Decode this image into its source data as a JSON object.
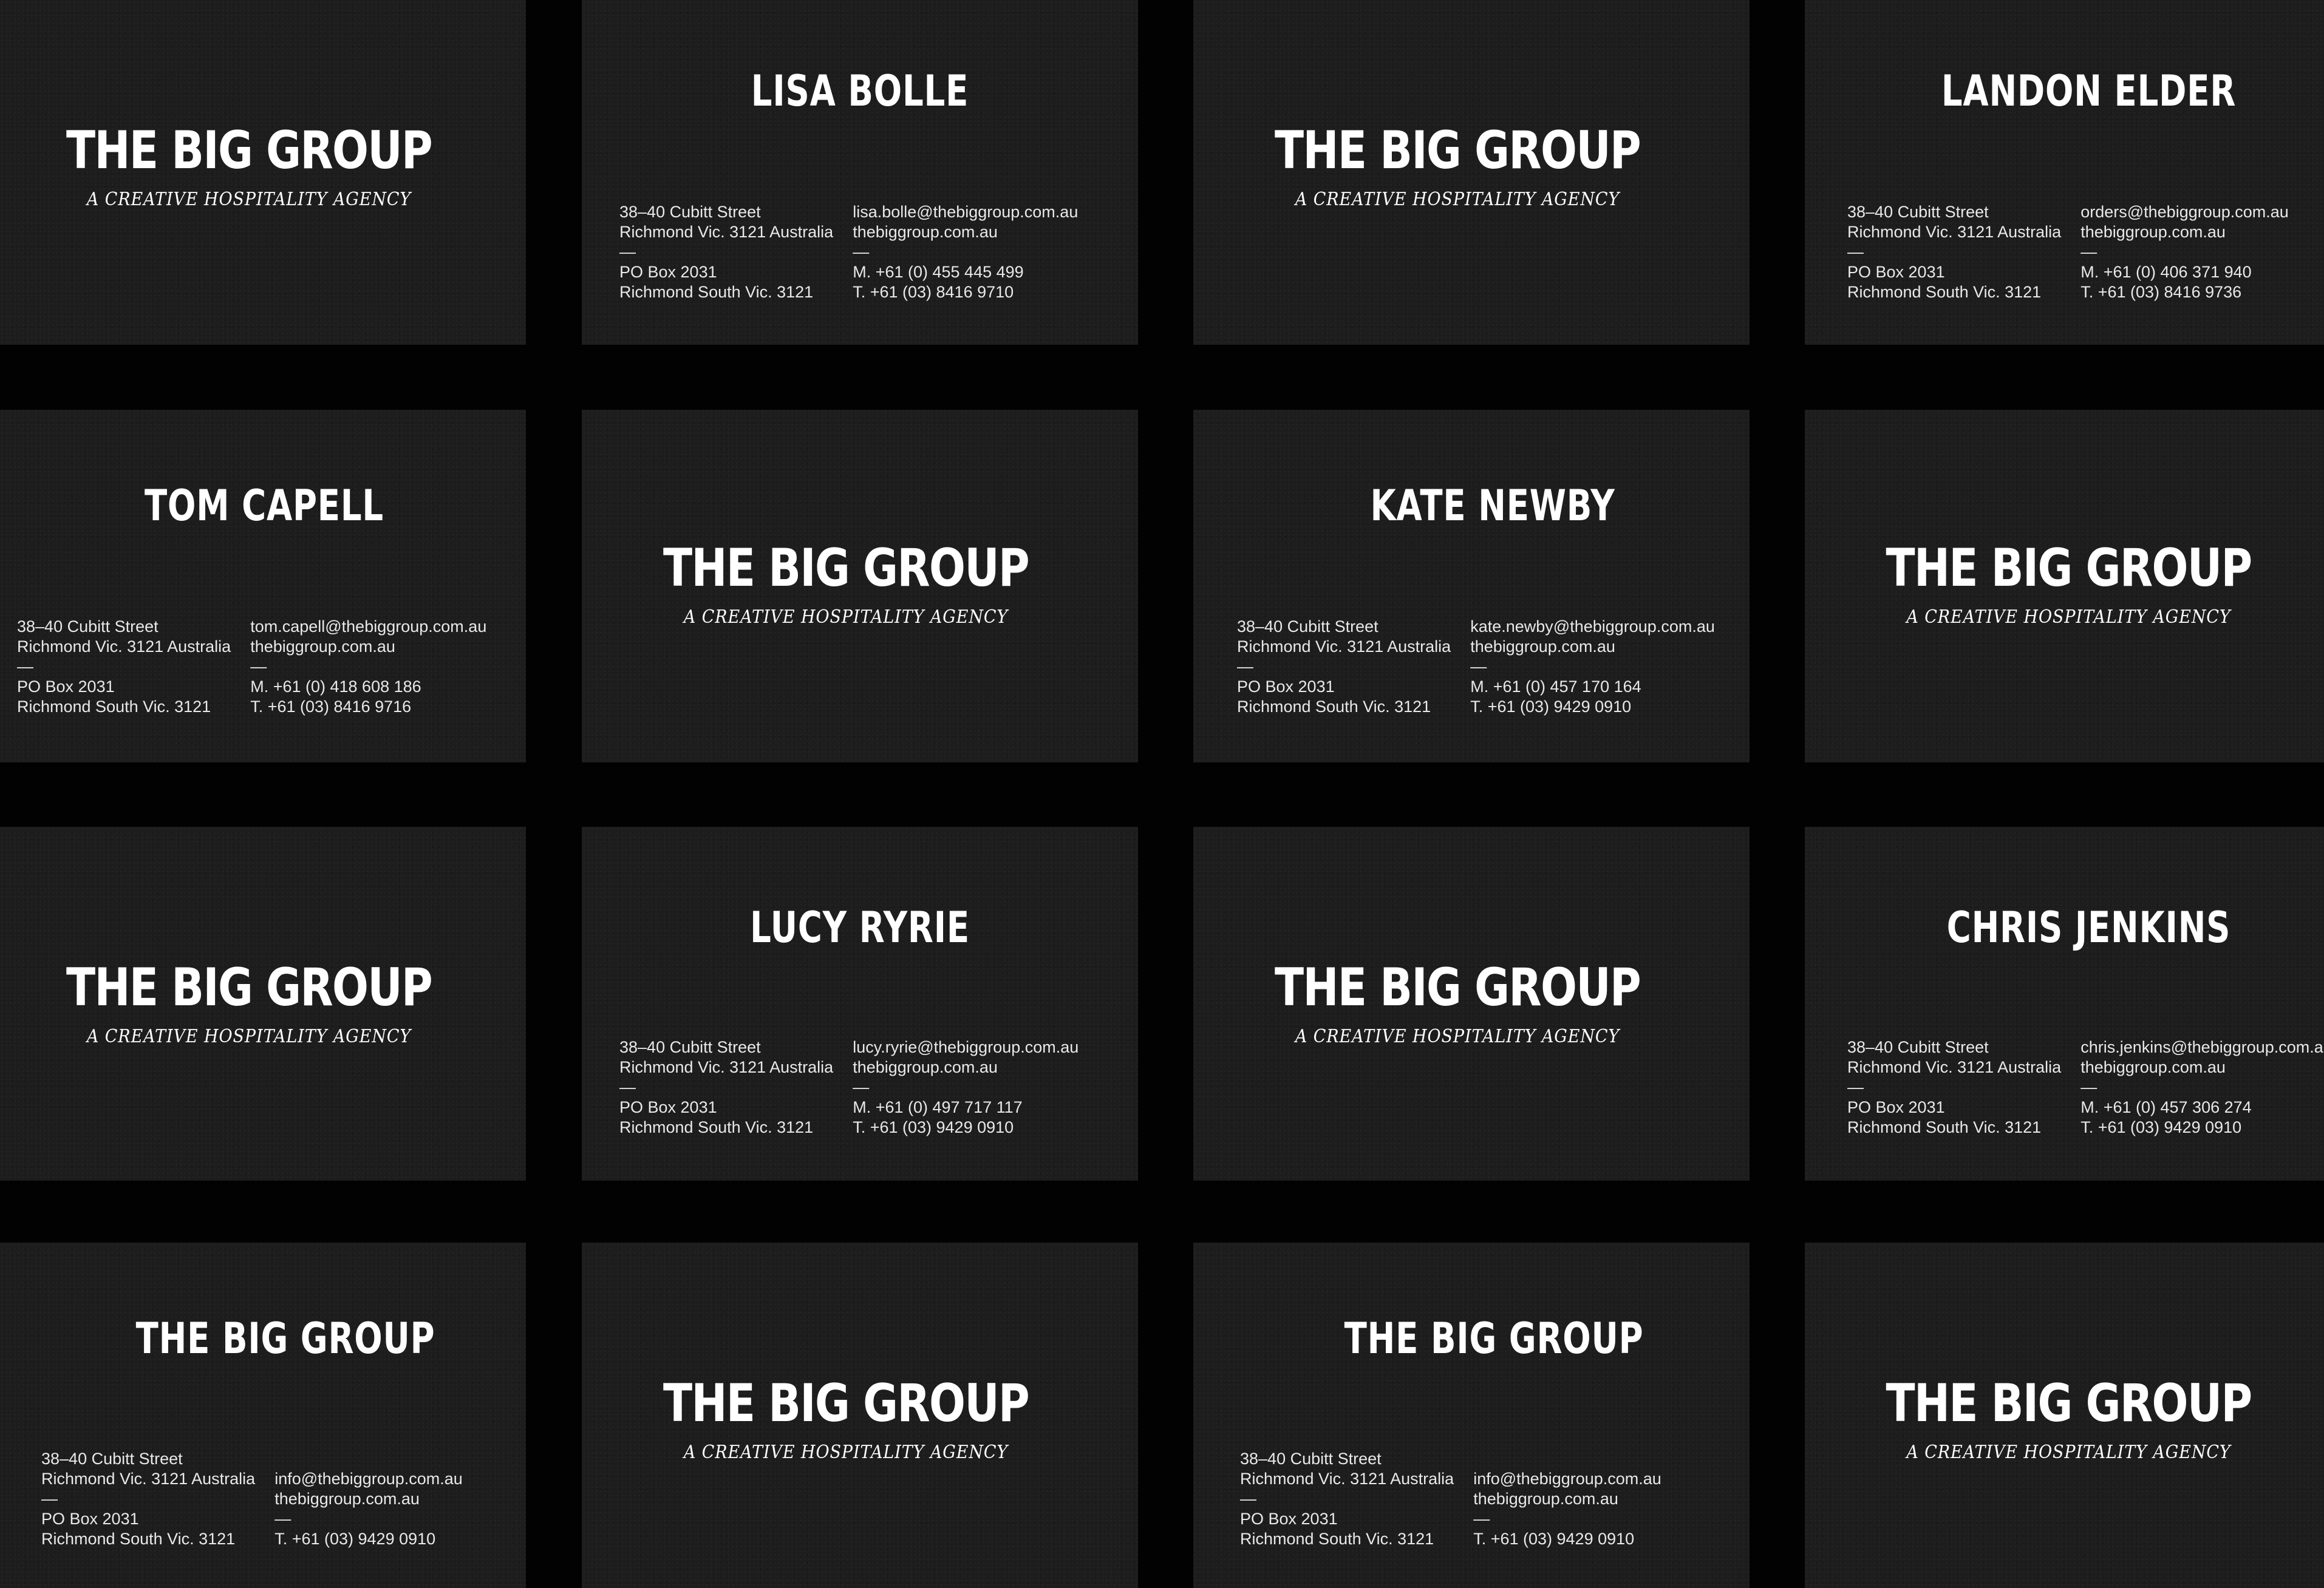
{
  "brand": {
    "logo": "THE BIG GROUP",
    "tagline": "A CREATIVE HOSPITALITY AGENCY"
  },
  "common": {
    "street": "38–40 Cubitt Street",
    "suburb": "Richmond Vic. 3121 Australia",
    "dash": "—",
    "po_box": "PO Box 2031",
    "po_suburb": "Richmond South Vic. 3121",
    "website": "thebiggroup.com.au"
  },
  "cards": {
    "lisa": {
      "name": "LISA BOLLE",
      "email": "lisa.bolle@thebiggroup.com.au",
      "mobile": "M. +61 (0) 455 445 499",
      "tel": "T.  +61 (03) 8416 9710"
    },
    "landon": {
      "name": "LANDON ELDER",
      "email": "orders@thebiggroup.com.au",
      "mobile": "M. +61 (0) 406 371 940",
      "tel": "T.  +61 (03) 8416 9736"
    },
    "tom": {
      "name": "TOM CAPELL",
      "email": "tom.capell@thebiggroup.com.au",
      "mobile": "M. +61 (0) 418 608 186",
      "tel": "T.  +61 (03) 8416 9716"
    },
    "kate": {
      "name": "KATE NEWBY",
      "email": "kate.newby@thebiggroup.com.au",
      "mobile": "M. +61 (0) 457 170 164",
      "tel": "T.  +61 (03) 9429 0910"
    },
    "lucy": {
      "name": "LUCY RYRIE",
      "email": "lucy.ryrie@thebiggroup.com.au",
      "mobile": "M. +61 (0) 497 717 117",
      "tel": "T.  +61 (03) 9429 0910"
    },
    "chris": {
      "name": "CHRIS JENKINS",
      "email": "chris.jenkins@thebiggroup.com.au",
      "mobile": "M. +61 (0) 457 306 274",
      "tel": "T.  +61 (03) 9429 0910"
    },
    "general1": {
      "name": "THE BIG GROUP",
      "email": "info@thebiggroup.com.au",
      "tel": "T.  +61 (03) 9429 0910"
    },
    "general2": {
      "name": "THE BIG GROUP",
      "email": "info@thebiggroup.com.au",
      "tel": "T.  +61 (03) 9429 0910"
    }
  },
  "colors": {
    "background": "#020202",
    "card": "#1d1d1d",
    "text": "#ffffff"
  }
}
